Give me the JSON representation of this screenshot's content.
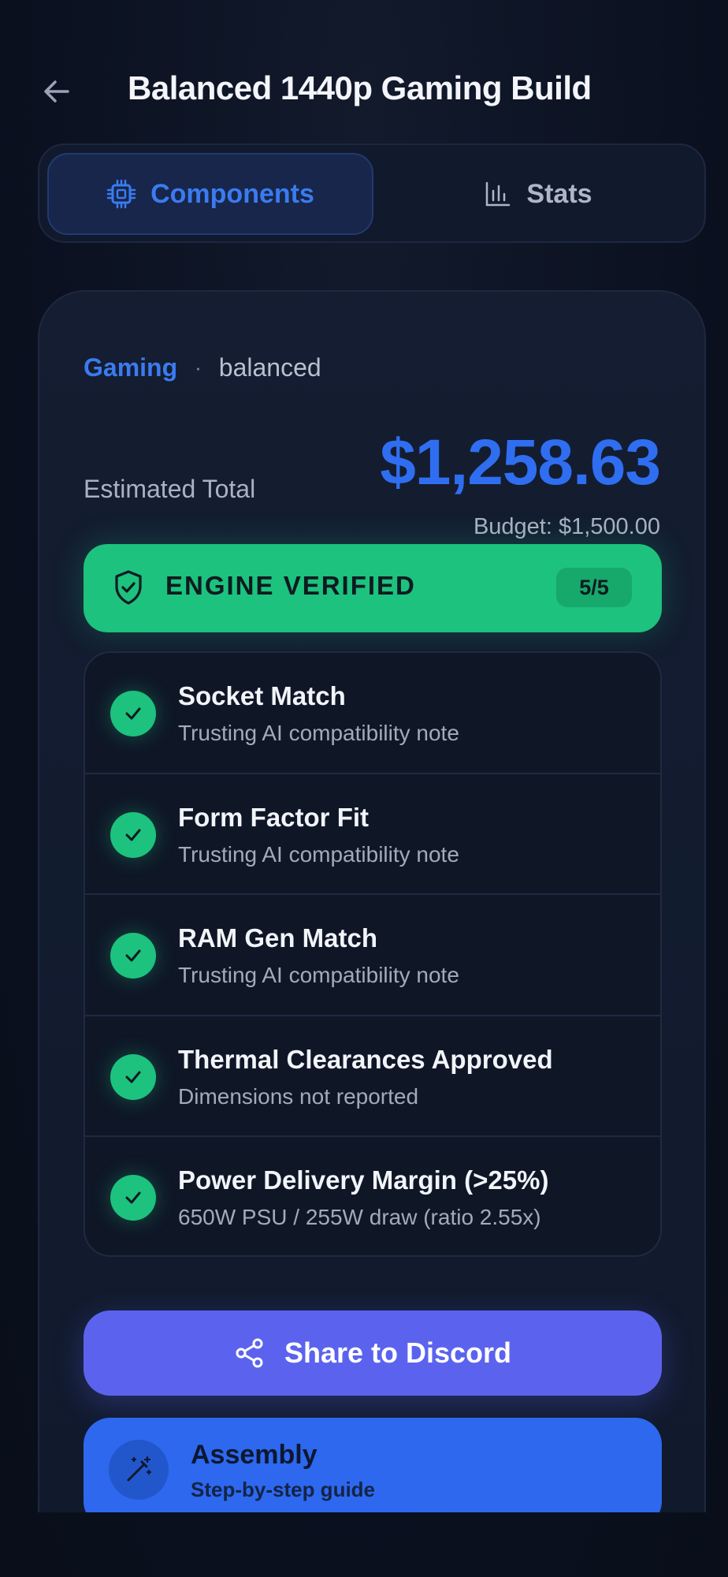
{
  "header": {
    "title": "Balanced 1440p Gaming Build",
    "back_icon": "arrow-left-icon"
  },
  "tabs": [
    {
      "label": "Components",
      "icon": "cpu-chip-icon",
      "active": true
    },
    {
      "label": "Stats",
      "icon": "bar-chart-icon",
      "active": false
    }
  ],
  "summary": {
    "category": "Gaming",
    "separator": "·",
    "style": "balanced",
    "total_label": "Estimated Total",
    "total_amount": "$1,258.63",
    "budget": "Budget: $1,500.00"
  },
  "verification": {
    "label": "ENGINE VERIFIED",
    "count": "5/5",
    "icon": "shield-check-icon",
    "color": "#1cc27e"
  },
  "checks": [
    {
      "title": "Socket Match",
      "subtitle": "Trusting AI compatibility note"
    },
    {
      "title": "Form Factor Fit",
      "subtitle": "Trusting AI compatibility note"
    },
    {
      "title": "RAM Gen Match",
      "subtitle": "Trusting AI compatibility note"
    },
    {
      "title": "Thermal Clearances Approved",
      "subtitle": "Dimensions not reported"
    },
    {
      "title": "Power Delivery Margin (>25%)",
      "subtitle": "650W PSU / 255W draw (ratio 2.55x)"
    }
  ],
  "actions": {
    "share_label": "Share to Discord",
    "share_icon": "share-icon",
    "assembly_title": "Assembly",
    "assembly_subtitle": "Step-by-step guide",
    "assembly_icon": "magic-wand-icon"
  },
  "colors": {
    "accent_blue": "#2f6ef0",
    "success_green": "#1cc27e",
    "discord_purple": "#5b63ee",
    "background": "#0b1120"
  }
}
